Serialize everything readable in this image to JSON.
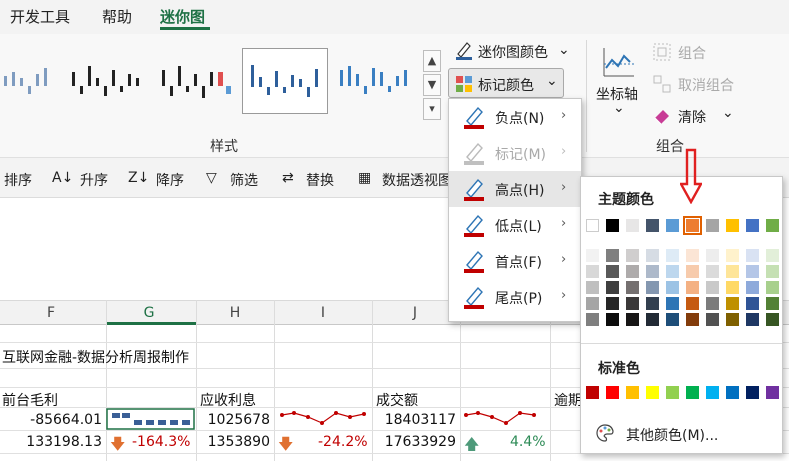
{
  "tabs": [
    {
      "label": "开发工具"
    },
    {
      "label": "帮助"
    },
    {
      "label": "迷你图"
    }
  ],
  "ribbon": {
    "style_group_label": "样式",
    "combine_group_label": "组合",
    "sparkline_color": "迷你图颜色",
    "marker_color": "标记颜色",
    "axis": "坐标轴",
    "group": "组合",
    "ungroup": "取消组合",
    "clear": "清除"
  },
  "datatools": {
    "sort": "排序",
    "asc": "升序",
    "desc": "降序",
    "filter": "筛选",
    "replace": "替换",
    "pivot": "数据透视图"
  },
  "menu": {
    "items": [
      {
        "label": "负点(N)",
        "enabled": true,
        "color": "#c00000"
      },
      {
        "label": "标记(M)",
        "enabled": false,
        "color": "#c00000"
      },
      {
        "label": "高点(H)",
        "enabled": true,
        "color": "#c00000"
      },
      {
        "label": "低点(L)",
        "enabled": true,
        "color": "#c00000"
      },
      {
        "label": "首点(F)",
        "enabled": true,
        "color": "#c00000"
      },
      {
        "label": "尾点(P)",
        "enabled": true,
        "color": "#c00000"
      }
    ]
  },
  "palette": {
    "theme_title": "主题颜色",
    "standard_title": "标准色",
    "more_colors": "其他颜色(M)...",
    "selected_color": "#ed7d31",
    "arrow_color": "#e02020",
    "theme_top": [
      "#ffffff",
      "#000000",
      "#e7e6e6",
      "#44546a",
      "#5b9bd5",
      "#ed7d31",
      "#a5a5a5",
      "#ffc000",
      "#4472c4",
      "#70ad47"
    ],
    "theme_shades": [
      [
        "#f2f2f2",
        "#7f7f7f",
        "#d0cece",
        "#d6dce4",
        "#deebf6",
        "#fbe5d5",
        "#ededed",
        "#fff2cc",
        "#d9e2f3",
        "#e2efd9"
      ],
      [
        "#d8d8d8",
        "#595959",
        "#aeabab",
        "#adb9ca",
        "#bdd7ee",
        "#f7cbac",
        "#dbdbdb",
        "#fee599",
        "#b4c6e7",
        "#c5e0b3"
      ],
      [
        "#bfbfbf",
        "#3f3f3f",
        "#757070",
        "#8497b0",
        "#9cc3e5",
        "#f4b183",
        "#c9c9c9",
        "#ffd965",
        "#8eaadb",
        "#a8d08d"
      ],
      [
        "#a5a5a5",
        "#262626",
        "#3a3838",
        "#323f4f",
        "#2e75b5",
        "#c55a11",
        "#7b7b7b",
        "#bf9000",
        "#2f5496",
        "#538135"
      ],
      [
        "#7f7f7f",
        "#0c0c0c",
        "#171616",
        "#222a35",
        "#1e4e79",
        "#833c0b",
        "#525252",
        "#7f6000",
        "#1f3864",
        "#375623"
      ]
    ],
    "standard": [
      "#c00000",
      "#ff0000",
      "#ffc000",
      "#ffff00",
      "#92d050",
      "#00b050",
      "#00b0f0",
      "#0070c0",
      "#002060",
      "#7030a0"
    ]
  },
  "sheet": {
    "columns": [
      "F",
      "G",
      "H",
      "I",
      "J"
    ],
    "title": "互联网金融-数据分析周报制作",
    "headers": {
      "F": "前台毛利",
      "H": "应收利息",
      "J": "成交额",
      "K": "逾期"
    },
    "row1": {
      "F": "-85664.01",
      "H": "1025678",
      "J": "18403117"
    },
    "row2": {
      "F": "133198.13",
      "G": "-164.3%",
      "H": "1353890",
      "I": "-24.2%",
      "J": "17633929",
      "K": "4.4%"
    }
  }
}
